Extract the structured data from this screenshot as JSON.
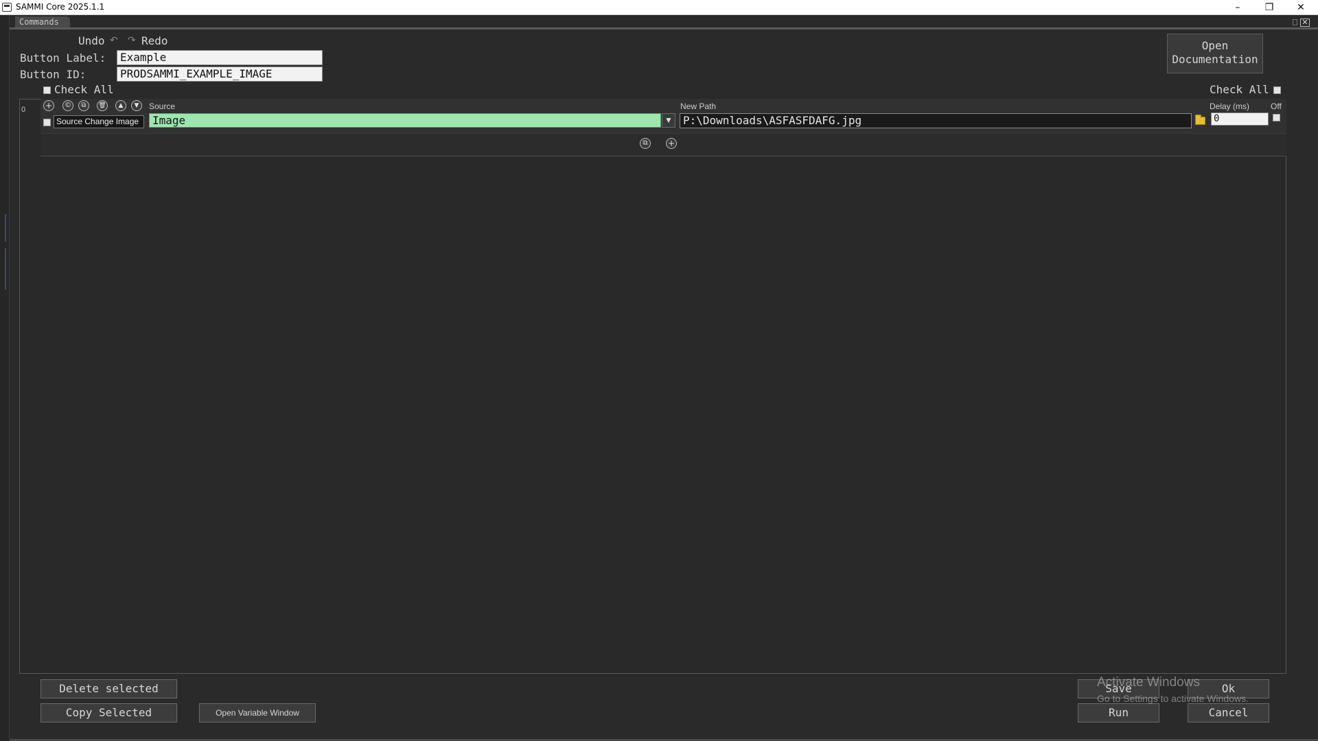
{
  "window": {
    "title": "SAMMI Core 2025.1.1",
    "minimize": "–",
    "restore": "❐",
    "close": "✕"
  },
  "tab": {
    "label": "Commands",
    "close": "✕"
  },
  "toolbar": {
    "undo_label": "Undo",
    "redo_label": "Redo",
    "undo_icon": "↶",
    "redo_icon": "↷"
  },
  "form": {
    "button_label_caption": "Button Label:",
    "button_label_value": "Example",
    "button_id_caption": "Button ID:",
    "button_id_value": "PRODSAMMI_EXAMPLE_IMAGE"
  },
  "open_documentation": {
    "line1": "Open",
    "line2": "Documentation"
  },
  "check_all_left": "Check All",
  "check_all_right": "Check All",
  "command_row": {
    "index": "0",
    "icons": {
      "add": "+",
      "copy": "©",
      "paste": "⧉",
      "delete": "🗑",
      "up": "▲",
      "down": "▼"
    },
    "command_name": "Source Change Image",
    "source_caption": "Source",
    "source_value": "Image",
    "source_dropdown": "▼",
    "new_path_caption": "New Path",
    "new_path_value": "P:\\Downloads\\ASFASFDAFG.jpg",
    "delay_caption": "Delay (ms)",
    "delay_value": "0",
    "off_caption": "Off"
  },
  "row_bar_icons": {
    "paste": "⧉",
    "add": "+"
  },
  "buttons": {
    "delete_selected": "Delete selected",
    "copy_selected": "Copy Selected",
    "open_variable_window": "Open Variable Window",
    "save": "Save",
    "ok": "Ok",
    "run": "Run",
    "cancel": "Cancel"
  },
  "watermark": {
    "line1": "Activate Windows",
    "line2": "Go to Settings to activate Windows."
  }
}
